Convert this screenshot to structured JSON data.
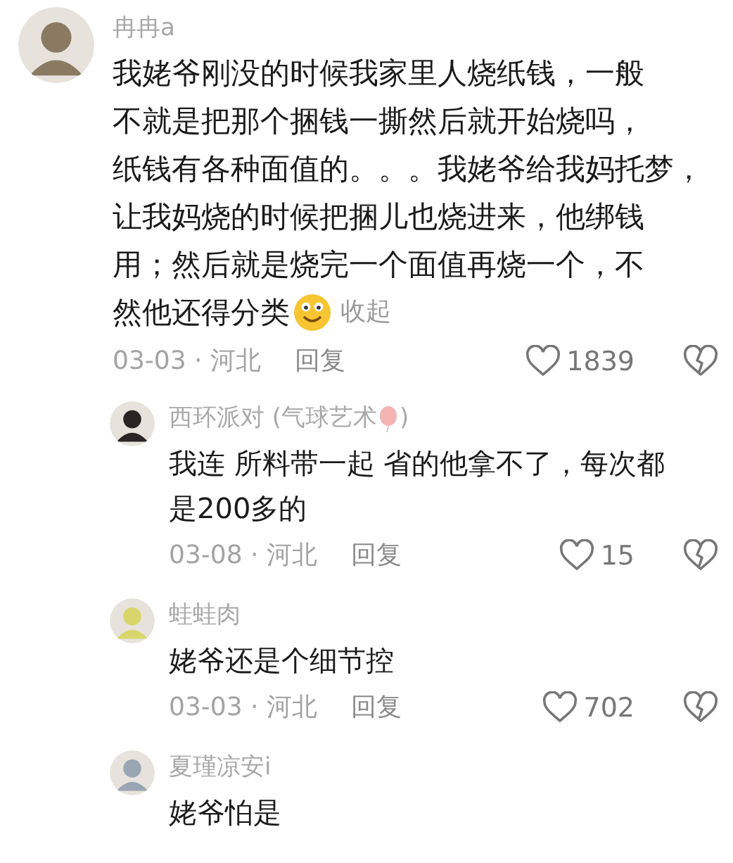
{
  "comment": {
    "author": "冉冉a",
    "text_lines": [
      "我姥爷刚没的时候我家里人烧纸钱，一般",
      "不就是把那个捆钱一撕然后就开始烧吗，",
      "纸钱有各种面值的。。。我姥爷给我妈托梦，",
      "让我妈烧的时候把捆儿也烧进来，他绑钱",
      "用；然后就是烧完一个面值再烧一个，不",
      "然他还得分类"
    ],
    "emoji": true,
    "collapse": "收起",
    "date": "03-03 · 河北",
    "reply": "回复",
    "likes": "1839",
    "replies": [
      {
        "author": "西环派对 (气球艺术",
        "author_end": ")",
        "name_badge": true,
        "text": "我连 所料带一起 省的他拿不了，每次都是200多的",
        "date": "03-08 · 河北",
        "reply": "回复",
        "likes": "15"
      },
      {
        "author": "蛙蛙肉",
        "name_badge": false,
        "text": "姥爷还是个细节控",
        "date": "03-03 · 河北",
        "reply": "回复",
        "likes": "702"
      },
      {
        "author": "夏瑾凉安i",
        "name_badge": false,
        "text": "姥爷怕是"
      }
    ]
  }
}
